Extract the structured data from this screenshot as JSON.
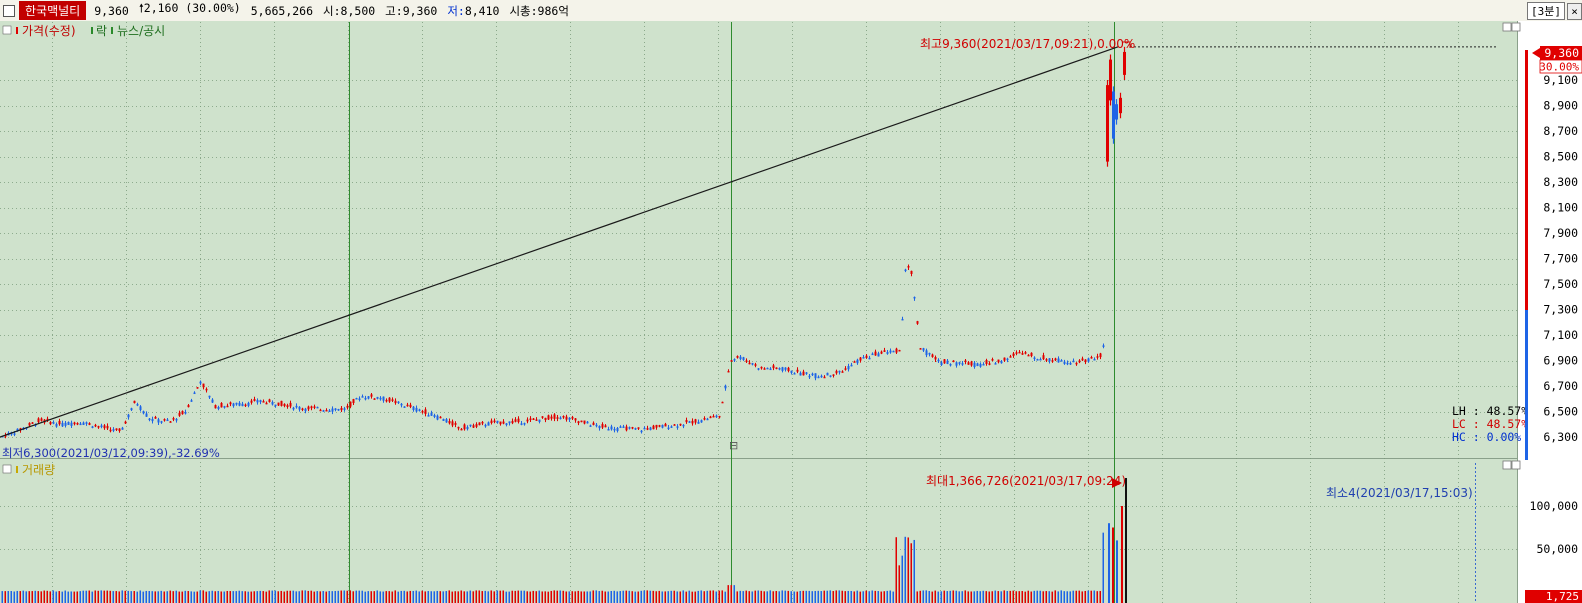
{
  "window": {
    "stock_name": "한국맥널티",
    "price": "9,360",
    "change": "2,160",
    "change_pct": "(30.00%)",
    "volume": "5,665,266",
    "open_label": "시:",
    "open_value": "8,500",
    "high_label": "고:",
    "high_value": "9,360",
    "low_label": "저:",
    "low_value": "8,410",
    "mcap_label": "시총:",
    "mcap_value": "986억",
    "period": "[3분]",
    "close_symbol": "×"
  },
  "price_panel": {
    "legend": [
      "가격(수정)",
      "락",
      "뉴스/공시"
    ],
    "max_annotation": "최고9,360(2021/03/17,09:21),0.00%",
    "min_annotation": "최저6,300(2021/03/12,09:39),-32.69%",
    "current_price_label": "9,360",
    "current_pct_label": "30.00%",
    "lh": "LH : 48.57%",
    "lc": "LC : 48.57%",
    "hc": "HC : 0.00%"
  },
  "volume_panel": {
    "legend": "거래량",
    "max_annotation": "최대1,366,726(2021/03/17,09:24)",
    "min_annotation": "최소4(2021/03/17,15:03)",
    "current_label": "1,725"
  },
  "colors": {
    "background": "#cfe2cc",
    "up": "#e00000",
    "down": "#1e64e6",
    "grid": "#7a9a7a",
    "divider": "#2e8b2e"
  },
  "chart_data": [
    {
      "type": "line",
      "description": "3-minute candlestick price chart",
      "y_ticks": [
        "9,100",
        "8,900",
        "8,700",
        "8,500",
        "8,300",
        "8,100",
        "7,900",
        "7,700",
        "7,500",
        "7,300",
        "7,100",
        "6,900",
        "6,700",
        "6,500",
        "6,300"
      ],
      "ylim": [
        6200,
        9450
      ],
      "price_path_x": [
        0,
        20,
        40,
        60,
        80,
        100,
        120,
        135,
        150,
        170,
        185,
        200,
        215,
        240,
        260,
        280,
        300,
        320,
        345,
        360,
        380,
        400,
        420,
        440,
        460,
        490,
        520,
        560,
        600,
        640,
        680,
        700,
        720,
        730,
        740,
        760,
        780,
        800,
        820,
        840,
        860,
        880,
        900,
        905,
        910,
        920,
        940,
        960,
        980,
        1000,
        1020,
        1040,
        1060,
        1080,
        1100,
        1106,
        1110,
        1115,
        1120,
        1125
      ],
      "price_path_y": [
        6300,
        6360,
        6430,
        6400,
        6420,
        6380,
        6340,
        6580,
        6440,
        6420,
        6500,
        6740,
        6540,
        6560,
        6580,
        6560,
        6530,
        6520,
        6520,
        6620,
        6610,
        6560,
        6510,
        6450,
        6370,
        6410,
        6420,
        6460,
        6380,
        6360,
        6400,
        6430,
        6470,
        6910,
        6930,
        6840,
        6840,
        6800,
        6780,
        6810,
        6910,
        6960,
        6980,
        7600,
        7650,
        7000,
        6890,
        6880,
        6870,
        6900,
        6960,
        6920,
        6900,
        6890,
        6940,
        7110,
        8420,
        9300,
        8900,
        9360
      ],
      "trendline": {
        "from": [
          0,
          6300
        ],
        "to": [
          1118,
          9360
        ]
      },
      "max_value": 9360,
      "min_value": 6300
    },
    {
      "type": "bar",
      "description": "volume",
      "y_ticks": [
        "100,000",
        "50,000"
      ],
      "ylim": [
        0,
        130000
      ]
    }
  ]
}
